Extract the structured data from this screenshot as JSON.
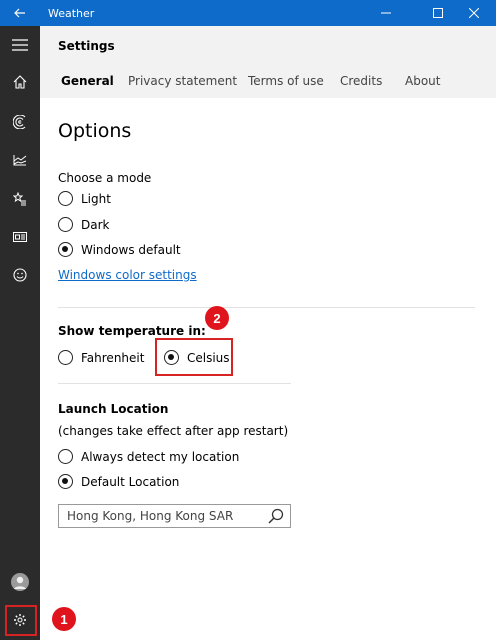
{
  "window": {
    "title": "Weather"
  },
  "titlebar": {
    "back_icon": "back-arrow-icon",
    "minimize_icon": "minimize-icon",
    "maximize_icon": "maximize-icon",
    "close_icon": "close-icon"
  },
  "sidebar": {
    "items": [
      {
        "icon": "hamburger-menu-icon"
      },
      {
        "icon": "home-icon"
      },
      {
        "icon": "maps-icon"
      },
      {
        "icon": "historical-weather-icon"
      },
      {
        "icon": "favorites-icon"
      },
      {
        "icon": "news-icon"
      },
      {
        "icon": "feedback-smiley-icon"
      },
      {
        "icon": "avatar"
      },
      {
        "icon": "settings-gear-icon"
      }
    ]
  },
  "header": {
    "title": "Settings",
    "tabs": [
      {
        "label": "General",
        "active": true
      },
      {
        "label": "Privacy statement"
      },
      {
        "label": "Terms of use"
      },
      {
        "label": "Credits"
      },
      {
        "label": "About"
      }
    ]
  },
  "options": {
    "title": "Options",
    "mode": {
      "label": "Choose a mode",
      "choices": [
        "Light",
        "Dark",
        "Windows default"
      ],
      "selected": "Windows default",
      "link": "Windows color settings"
    },
    "temperature": {
      "label": "Show temperature in:",
      "choices": [
        "Fahrenheit",
        "Celsius"
      ],
      "selected": "Celsius"
    },
    "launch": {
      "label": "Launch Location",
      "note": "(changes take effect after app restart)",
      "choices": [
        "Always detect my location",
        "Default Location"
      ],
      "selected": "Default Location",
      "location_value": "Hong Kong, Hong Kong SAR"
    }
  },
  "annotations": {
    "badge1": "1",
    "badge2": "2",
    "highlight_color": "#d62424"
  },
  "colors": {
    "accent": "#0f6bc9",
    "sidebar": "#2b2b2b",
    "header": "#f2f2f2"
  }
}
